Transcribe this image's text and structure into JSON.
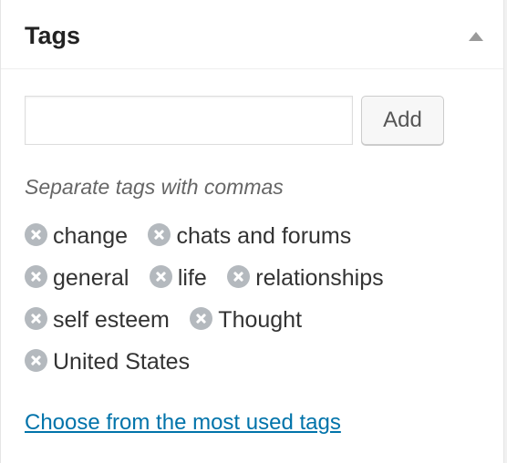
{
  "box": {
    "title": "Tags",
    "toggle_icon": "triangle-up-icon"
  },
  "input": {
    "value": "",
    "placeholder": ""
  },
  "add_button_label": "Add",
  "howto": "Separate tags with commas",
  "tags": [
    "change",
    "chats and forums",
    "general",
    "life",
    "relationships",
    "self esteem",
    "Thought",
    "United States"
  ],
  "remove_icon": "remove-circle-x-icon",
  "most_used_link": "Choose from the most used tags",
  "colors": {
    "link": "#0073aa",
    "remove_icon": "#b4b9be"
  }
}
